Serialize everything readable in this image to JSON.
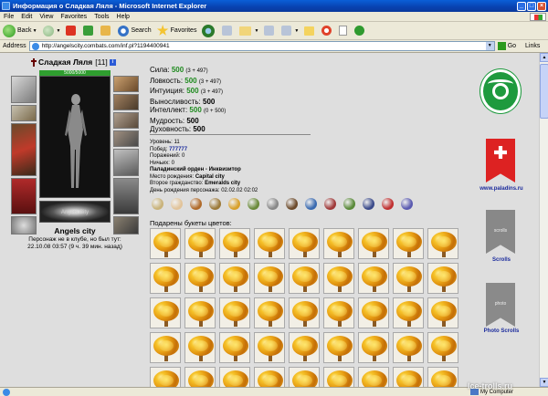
{
  "window": {
    "title": "Информация о Сладкая Ляля - Microsoft Internet Explorer"
  },
  "menu": [
    "File",
    "Edit",
    "View",
    "Favorites",
    "Tools",
    "Help"
  ],
  "toolbar": {
    "back": "Back",
    "search": "Search",
    "favorites": "Favorites"
  },
  "address": {
    "label": "Address",
    "url": "http://angelscity.combats.com/inf.pl?1194400941",
    "go": "Go",
    "links": "Links"
  },
  "character": {
    "name": "Сладкая Ляля",
    "level": "[11]",
    "info_badge": "i",
    "hp": "5000/5000",
    "logo_text": "Angels City",
    "city": "Angels city",
    "status_line1": "Персонаж не в клубе, но был тут:",
    "status_line2": "22.10.08 03:57 (9 ч. 39 мин. назад)"
  },
  "stats": [
    {
      "label": "Сила:",
      "value": "500",
      "bonus": "(3 + 497)",
      "color": "green"
    },
    {
      "label": "Ловкость:",
      "value": "500",
      "bonus": "(3 + 497)",
      "color": "green"
    },
    {
      "label": "Интуиция:",
      "value": "500",
      "bonus": "(3 + 497)",
      "color": "green"
    },
    {
      "label": "Выносливость:",
      "value": "500",
      "bonus": "",
      "color": "black"
    },
    {
      "label": "Интеллект:",
      "value": "500",
      "bonus": "(0 + 500)",
      "color": "green"
    },
    {
      "label": "Мудрость:",
      "value": "500",
      "bonus": "",
      "color": "black"
    },
    {
      "label": "Духовность:",
      "value": "500",
      "bonus": "",
      "color": "black"
    }
  ],
  "info": {
    "level_label": "Уровень:",
    "level_value": "11",
    "wins_label": "Побед:",
    "wins_value": "777777",
    "losses_label": "Поражений:",
    "losses_value": "0",
    "draws_label": "Ничьих:",
    "draws_value": "0",
    "order": "Паладинский орден - Инквизитор",
    "birthplace_label": "Место рождения:",
    "birthplace_value": "Capital city",
    "second_citizenship_label": "Второе гражданство:",
    "second_citizenship_value": "Emeralds city",
    "birthday_label": "День рождения персонажа:",
    "birthday_value": "02.02.02 02:02"
  },
  "badges": [
    {
      "name": "scroll-badge-icon",
      "color": "#c9b37a"
    },
    {
      "name": "hand-badge-icon",
      "color": "#e2c49a"
    },
    {
      "name": "shield-badge-icon",
      "color": "#b06a2a"
    },
    {
      "name": "crest-badge-icon",
      "color": "#9c7a3a"
    },
    {
      "name": "sun-badge-icon",
      "color": "#d8a02a"
    },
    {
      "name": "ring-badge-icon",
      "color": "#6a8a3a"
    },
    {
      "name": "mouse-badge-icon",
      "color": "#888888"
    },
    {
      "name": "knight-badge-icon",
      "color": "#6c4a2a"
    },
    {
      "name": "star-badge-icon",
      "color": "#3a6ab0"
    },
    {
      "name": "emblem-badge-icon",
      "color": "#a03a3a"
    },
    {
      "name": "wreath-badge-icon",
      "color": "#5a8a3a"
    },
    {
      "name": "seal-badge-icon",
      "color": "#3a4a8a"
    },
    {
      "name": "flame-badge-icon",
      "color": "#c03030"
    },
    {
      "name": "flower-badge-icon",
      "color": "#5a5ab0"
    }
  ],
  "bouquets": {
    "title": "Подарены букеты цветов:",
    "count": 45
  },
  "rail": {
    "paladins_link": "www.paladins.ru",
    "scrolls_link": "Scrolls",
    "photo_scrolls_link": "Photo Scrolls",
    "scrolls_banner_text": "scrolls",
    "photo_banner_text": "photo"
  },
  "status": {
    "zone": "My Computer",
    "watermark": "Ice-trolls.ru"
  },
  "colors": {
    "stat_green": "#1e8a1e",
    "info_blue": "#1a2a9c",
    "paladin_green": "#1e9a3e",
    "paladin_red": "#d22222"
  }
}
